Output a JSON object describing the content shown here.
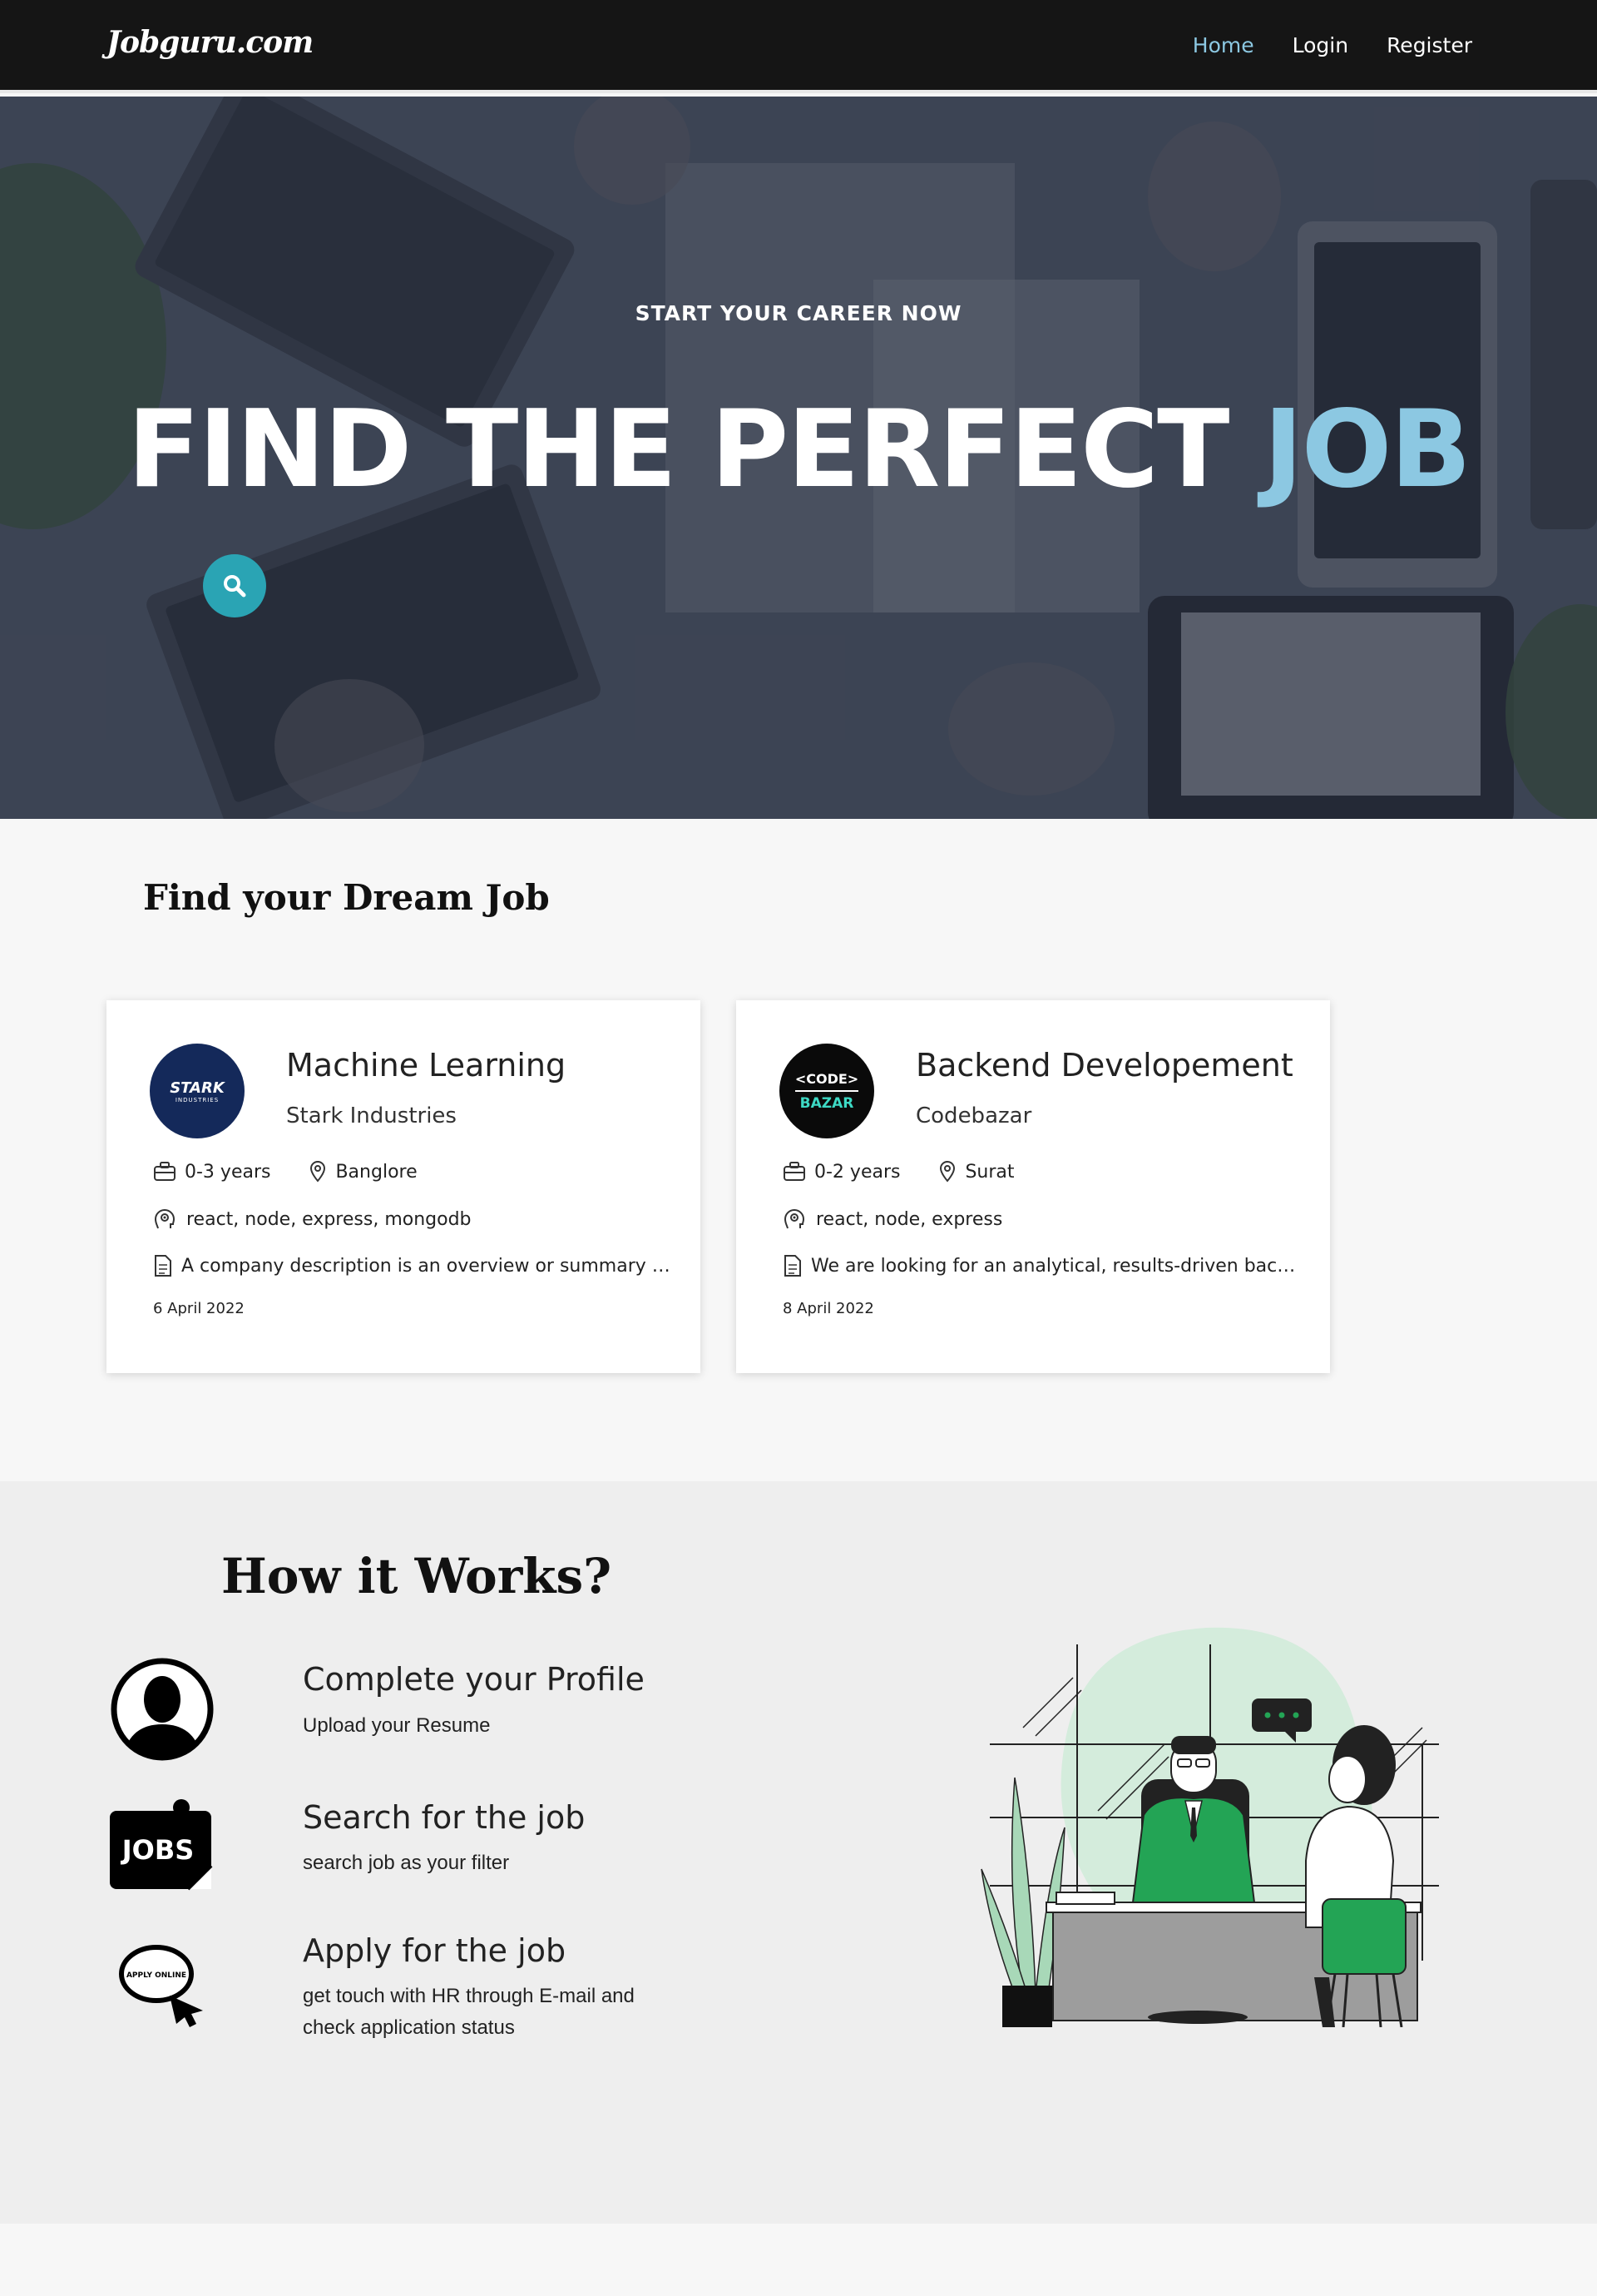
{
  "navbar": {
    "brand": "Jobguru.com",
    "links": [
      {
        "label": "Home",
        "active": true
      },
      {
        "label": "Login",
        "active": false
      },
      {
        "label": "Register",
        "active": false
      }
    ]
  },
  "hero": {
    "tagline": "START YOUR CAREER NOW",
    "title_main": "FIND THE PERFECT ",
    "title_accent": "JOB",
    "accent_color": "#8cc8e2",
    "search_icon": "search-icon"
  },
  "dream_section": {
    "title": "Find your Dream Job",
    "jobs": [
      {
        "title": "Machine Learning",
        "company": "Stark Industries",
        "logo_text": "STARK",
        "logo_subtext": "INDUSTRIES",
        "logo_color": "#14295a",
        "experience": "0-3 years",
        "location": "Banglore",
        "skills": "react, node, express, mongodb",
        "description": "A company description is an overview or summary of a business, including its history, mission and services.",
        "date": "6 April 2022"
      },
      {
        "title": "Backend Developement",
        "company": "Codebazar",
        "logo_text": "<CODE>",
        "logo_subtext": "BAZAR",
        "logo_color": "#0a0a0a",
        "experience": "0-2 years",
        "location": "Surat",
        "skills": "react, node, express",
        "description": "We are looking for an analytical, results-driven back-end developer to join our team.",
        "date": "8 April 2022"
      }
    ]
  },
  "how_it_works": {
    "title": "How it Works?",
    "steps": [
      {
        "title": "Complete your Profile",
        "description": "Upload your Resume",
        "icon": "user-profile-icon"
      },
      {
        "title": "Search for the job",
        "description": "search job as your filter",
        "icon": "jobs-sign-icon",
        "icon_text": "JOBS"
      },
      {
        "title": "Apply for the job",
        "description": "get touch with HR through E-mail and check application status",
        "icon": "apply-online-icon",
        "icon_text": "APPLY ONLINE"
      }
    ],
    "illustration": "job-interview-illustration",
    "illustration_accent": "#23a455"
  }
}
